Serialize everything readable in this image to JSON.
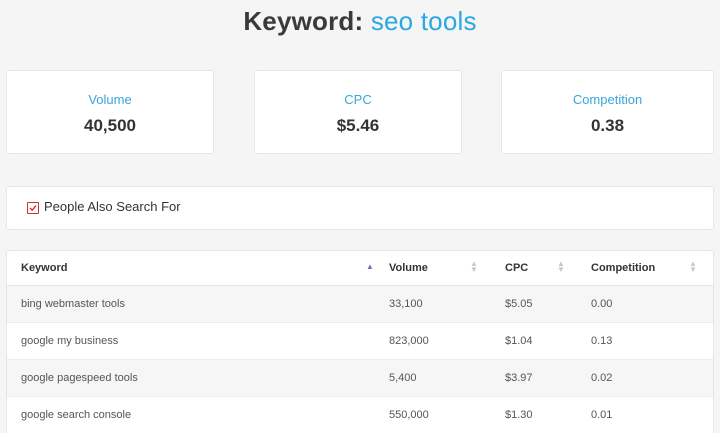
{
  "header": {
    "prefix": "Keyword:",
    "keyword": "seo tools"
  },
  "stats": {
    "volume": {
      "label": "Volume",
      "value": "40,500"
    },
    "cpc": {
      "label": "CPC",
      "value": "$5.46"
    },
    "competition": {
      "label": "Competition",
      "value": "0.38"
    }
  },
  "people_also_search": {
    "label": "People Also Search For",
    "checked": true,
    "check_color": "#d0312d"
  },
  "table": {
    "columns": [
      "Keyword",
      "Volume",
      "CPC",
      "Competition"
    ],
    "sort": {
      "column": "Keyword",
      "direction": "asc",
      "active_color": "#7b67c9"
    },
    "rows": [
      {
        "keyword": "bing webmaster tools",
        "volume": "33,100",
        "cpc": "$5.05",
        "competition": "0.00"
      },
      {
        "keyword": "google my business",
        "volume": "823,000",
        "cpc": "$1.04",
        "competition": "0.13"
      },
      {
        "keyword": "google pagespeed tools",
        "volume": "5,400",
        "cpc": "$3.97",
        "competition": "0.02"
      },
      {
        "keyword": "google search console",
        "volume": "550,000",
        "cpc": "$1.30",
        "competition": "0.01"
      }
    ]
  },
  "colors": {
    "accent": "#29a9e1",
    "background": "#f5f5f5"
  }
}
